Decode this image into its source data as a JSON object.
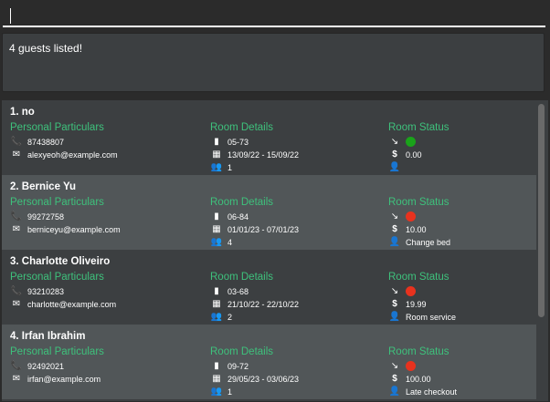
{
  "command_box": {
    "value": ""
  },
  "result": {
    "message": "4 guests listed!"
  },
  "headings": {
    "personal": "Personal Particulars",
    "room_details": "Room Details",
    "room_status": "Room Status"
  },
  "guests": [
    {
      "title": "1.  no",
      "phone": "87438807",
      "email": "alexyeoh@example.com",
      "room": "05-73",
      "dates": "13/09/22 - 15/09/22",
      "guests": "1",
      "status_color": "#1aa31a",
      "bill": "0.00",
      "request": ""
    },
    {
      "title": "2.  Bernice Yu",
      "phone": "99272758",
      "email": "berniceyu@example.com",
      "room": "06-84",
      "dates": "01/01/23 - 07/01/23",
      "guests": "4",
      "status_color": "#e8321e",
      "bill": "10.00",
      "request": "Change bed"
    },
    {
      "title": "3.  Charlotte Oliveiro",
      "phone": "93210283",
      "email": "charlotte@example.com",
      "room": "03-68",
      "dates": "21/10/22 - 22/10/22",
      "guests": "2",
      "status_color": "#e8321e",
      "bill": "19.99",
      "request": "Room service"
    },
    {
      "title": "4.  Irfan Ibrahim",
      "phone": "92492021",
      "email": "irfan@example.com",
      "room": "09-72",
      "dates": "29/05/23 - 03/06/23",
      "guests": "1",
      "status_color": "#e8321e",
      "bill": "100.00",
      "request": "Late checkout"
    }
  ]
}
